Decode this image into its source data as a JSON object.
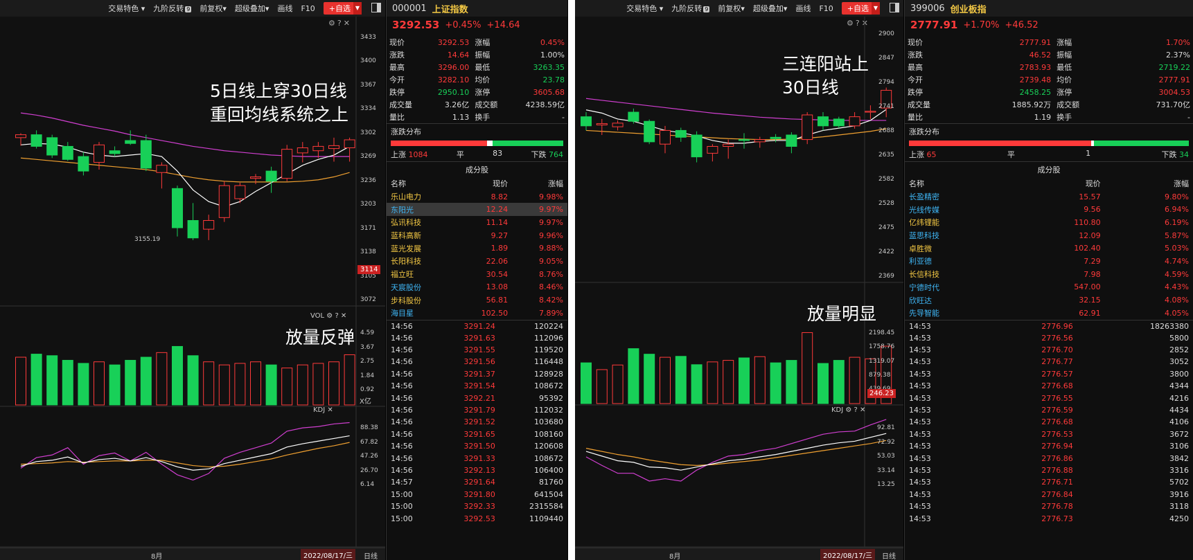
{
  "left_panel": {
    "toolbar": {
      "trade_feature": "交易特色",
      "nine_reversal": "九阶反转",
      "nine_badge": "9",
      "pre_adjust": "前复权",
      "overlay": "超级叠加",
      "draw_line": "画线",
      "f10": "F10",
      "add_watch": "+自选"
    },
    "price_axis": [
      "3433",
      "3400",
      "3367",
      "3334",
      "3302",
      "3269",
      "3236",
      "3203",
      "3171",
      "3138",
      "3105",
      "3072"
    ],
    "current_price_tag": "3114",
    "low_marker": "3155.19",
    "annotation_line1": "5日线上穿30日线",
    "annotation_line2": "重回均线系统之上",
    "vol_label": "VOL",
    "vol_axis": [
      "4.59",
      "3.67",
      "2.75",
      "1.84",
      "0.92"
    ],
    "vol_unit": "X亿",
    "vol_annotation": "放量反弹",
    "kdj_label": "KDJ",
    "kdj_axis": [
      "88.38",
      "67.82",
      "47.26",
      "26.70",
      "6.14"
    ],
    "month_label": "8月",
    "date_label": "2022/08/17/三",
    "period_label": "日线"
  },
  "left_quote": {
    "code": "000001",
    "name": "上证指数",
    "price": "3292.53",
    "pct": "+0.45%",
    "chg": "+14.64",
    "rows": [
      {
        "k1": "现价",
        "v1": "3292.53",
        "c1": "red",
        "k2": "涨幅",
        "v2": "0.45%",
        "c2": "red"
      },
      {
        "k1": "涨跌",
        "v1": "14.64",
        "c1": "red",
        "k2": "振幅",
        "v2": "1.00%",
        "c2": "white"
      },
      {
        "k1": "最高",
        "v1": "3296.00",
        "c1": "red",
        "k2": "最低",
        "v2": "3263.35",
        "c2": "green"
      },
      {
        "k1": "今开",
        "v1": "3282.10",
        "c1": "red",
        "k2": "均价",
        "v2": "23.78",
        "c2": "green"
      },
      {
        "k1": "跌停",
        "v1": "2950.10",
        "c1": "green",
        "k2": "涨停",
        "v2": "3605.68",
        "c2": "red"
      },
      {
        "k1": "成交量",
        "v1": "3.26亿",
        "c1": "white",
        "k2": "成交额",
        "v2": "4238.59亿",
        "c2": "white"
      },
      {
        "k1": "量比",
        "v1": "1.13",
        "c1": "white",
        "k2": "换手",
        "v2": "-",
        "c2": "white"
      }
    ],
    "dist_title": "涨跌分布",
    "up_label": "上涨",
    "up_count": "1084",
    "flat_label": "平",
    "flat_count": "83",
    "down_label": "下跌",
    "down_count": "764",
    "dist_up_frac": 0.56,
    "dist_flat_frac": 0.03,
    "const_title": "成分股",
    "const_headers": [
      "名称",
      "现价",
      "涨幅"
    ],
    "constituents": [
      {
        "name": "乐山电力",
        "price": "8.82",
        "pct": "9.98%",
        "nc": "yellow"
      },
      {
        "name": "东阳光",
        "price": "12.24",
        "pct": "9.97%",
        "nc": "blue"
      },
      {
        "name": "弘讯科技",
        "price": "11.14",
        "pct": "9.97%",
        "nc": "yellow"
      },
      {
        "name": "蓝科高新",
        "price": "9.27",
        "pct": "9.96%",
        "nc": "yellow"
      },
      {
        "name": "蓝光发展",
        "price": "1.89",
        "pct": "9.88%",
        "nc": "yellow"
      },
      {
        "name": "长阳科技",
        "price": "22.06",
        "pct": "9.05%",
        "nc": "yellow"
      },
      {
        "name": "福立旺",
        "price": "30.54",
        "pct": "8.76%",
        "nc": "yellow"
      },
      {
        "name": "天宸股份",
        "price": "13.08",
        "pct": "8.46%",
        "nc": "blue"
      },
      {
        "name": "步科股份",
        "price": "56.81",
        "pct": "8.42%",
        "nc": "yellow"
      },
      {
        "name": "海目星",
        "price": "102.50",
        "pct": "7.89%",
        "nc": "blue"
      }
    ],
    "ticks": [
      [
        "14:56",
        "3291.24",
        "120224"
      ],
      [
        "14:56",
        "3291.63",
        "112096"
      ],
      [
        "14:56",
        "3291.55",
        "119520"
      ],
      [
        "14:56",
        "3291.56",
        "116448"
      ],
      [
        "14:56",
        "3291.37",
        "128928"
      ],
      [
        "14:56",
        "3291.54",
        "108672"
      ],
      [
        "14:56",
        "3292.21",
        "95392"
      ],
      [
        "14:56",
        "3291.79",
        "112032"
      ],
      [
        "14:56",
        "3291.52",
        "103680"
      ],
      [
        "14:56",
        "3291.65",
        "108160"
      ],
      [
        "14:56",
        "3291.50",
        "120608"
      ],
      [
        "14:56",
        "3291.33",
        "108672"
      ],
      [
        "14:56",
        "3292.13",
        "106400"
      ],
      [
        "14:57",
        "3291.64",
        "81760"
      ],
      [
        "15:00",
        "3291.80",
        "641504"
      ],
      [
        "15:00",
        "3292.33",
        "2315584"
      ],
      [
        "15:00",
        "3292.53",
        "1109440"
      ]
    ]
  },
  "right_panel": {
    "toolbar": {
      "trade_feature": "交易特色",
      "nine_reversal": "九阶反转",
      "nine_badge": "9",
      "pre_adjust": "前复权",
      "overlay": "超级叠加",
      "draw_line": "画线",
      "f10": "F10",
      "add_watch": "+自选"
    },
    "price_axis": [
      "2900",
      "2847",
      "2794",
      "2741",
      "2688",
      "2635",
      "2582",
      "2528",
      "2475",
      "2422",
      "2369"
    ],
    "annotation_line1": "三连阳站上",
    "annotation_line2": "30日线",
    "vol_annotation": "放量明显",
    "vol_axis": [
      "2198.45",
      "1758.76",
      "1319.07",
      "879.38",
      "439.69"
    ],
    "current_vol_tag": "246.23",
    "kdj_label": "KDJ",
    "kdj_axis": [
      "92.81",
      "72.92",
      "53.03",
      "33.14",
      "13.25"
    ],
    "month_label": "8月",
    "date_label": "2022/08/17/三",
    "period_label": "日线"
  },
  "right_quote": {
    "code": "399006",
    "name": "创业板指",
    "price": "2777.91",
    "pct": "+1.70%",
    "chg": "+46.52",
    "rows": [
      {
        "k1": "现价",
        "v1": "2777.91",
        "c1": "red",
        "k2": "涨幅",
        "v2": "1.70%",
        "c2": "red"
      },
      {
        "k1": "涨跌",
        "v1": "46.52",
        "c1": "red",
        "k2": "振幅",
        "v2": "2.37%",
        "c2": "white"
      },
      {
        "k1": "最高",
        "v1": "2783.93",
        "c1": "red",
        "k2": "最低",
        "v2": "2719.22",
        "c2": "green"
      },
      {
        "k1": "今开",
        "v1": "2739.48",
        "c1": "red",
        "k2": "均价",
        "v2": "2777.91",
        "c2": "red"
      },
      {
        "k1": "跌停",
        "v1": "2458.25",
        "c1": "green",
        "k2": "涨停",
        "v2": "3004.53",
        "c2": "red"
      },
      {
        "k1": "成交量",
        "v1": "1885.92万",
        "c1": "white",
        "k2": "成交额",
        "v2": "731.70亿",
        "c2": "white"
      },
      {
        "k1": "量比",
        "v1": "1.19",
        "c1": "white",
        "k2": "换手",
        "v2": "-",
        "c2": "white"
      }
    ],
    "dist_title": "涨跌分布",
    "up_label": "上涨",
    "up_count": "65",
    "flat_label": "平",
    "flat_count": "1",
    "down_label": "下跌",
    "down_count": "34",
    "dist_up_frac": 0.65,
    "dist_flat_frac": 0.01,
    "const_title": "成分股",
    "const_headers": [
      "名称",
      "现价",
      "涨幅"
    ],
    "constituents": [
      {
        "name": "长盈精密",
        "price": "15.57",
        "pct": "9.80%",
        "nc": "blue"
      },
      {
        "name": "光线传媒",
        "price": "9.56",
        "pct": "6.94%",
        "nc": "blue"
      },
      {
        "name": "亿纬锂能",
        "price": "110.80",
        "pct": "6.19%",
        "nc": "yellow"
      },
      {
        "name": "蓝思科技",
        "price": "12.09",
        "pct": "5.87%",
        "nc": "blue"
      },
      {
        "name": "卓胜微",
        "price": "102.40",
        "pct": "5.03%",
        "nc": "yellow"
      },
      {
        "name": "利亚德",
        "price": "7.29",
        "pct": "4.74%",
        "nc": "blue"
      },
      {
        "name": "长信科技",
        "price": "7.98",
        "pct": "4.59%",
        "nc": "yellow"
      },
      {
        "name": "宁德时代",
        "price": "547.00",
        "pct": "4.43%",
        "nc": "blue"
      },
      {
        "name": "欣旺达",
        "price": "32.15",
        "pct": "4.08%",
        "nc": "blue"
      },
      {
        "name": "先导智能",
        "price": "62.91",
        "pct": "4.05%",
        "nc": "blue"
      }
    ],
    "ticks": [
      [
        "14:53",
        "2776.96",
        "18263380"
      ],
      [
        "14:53",
        "2776.56",
        "5800"
      ],
      [
        "14:53",
        "2776.70",
        "2852"
      ],
      [
        "14:53",
        "2776.77",
        "3052"
      ],
      [
        "14:53",
        "2776.57",
        "3800"
      ],
      [
        "14:53",
        "2776.68",
        "4344"
      ],
      [
        "14:53",
        "2776.55",
        "4216"
      ],
      [
        "14:53",
        "2776.59",
        "4434"
      ],
      [
        "14:53",
        "2776.68",
        "4106"
      ],
      [
        "14:53",
        "2776.53",
        "3672"
      ],
      [
        "14:53",
        "2776.94",
        "3106"
      ],
      [
        "14:53",
        "2776.86",
        "3842"
      ],
      [
        "14:53",
        "2776.88",
        "3316"
      ],
      [
        "14:53",
        "2776.71",
        "5702"
      ],
      [
        "14:53",
        "2776.84",
        "3916"
      ],
      [
        "14:53",
        "2776.78",
        "3118"
      ],
      [
        "14:53",
        "2776.73",
        "4250"
      ]
    ]
  },
  "chart_data": [
    {
      "type": "candlestick",
      "title": "上证指数",
      "ylim": [
        3072,
        3433
      ],
      "candles": [
        {
          "o": 3296,
          "h": 3302,
          "l": 3285,
          "c": 3300
        },
        {
          "o": 3300,
          "h": 3306,
          "l": 3281,
          "c": 3284
        },
        {
          "o": 3296,
          "h": 3300,
          "l": 3268,
          "c": 3272
        },
        {
          "o": 3284,
          "h": 3290,
          "l": 3264,
          "c": 3266
        },
        {
          "o": 3270,
          "h": 3276,
          "l": 3244,
          "c": 3250
        },
        {
          "o": 3262,
          "h": 3290,
          "l": 3252,
          "c": 3286
        },
        {
          "o": 3278,
          "h": 3284,
          "l": 3270,
          "c": 3274
        },
        {
          "o": 3292,
          "h": 3306,
          "l": 3286,
          "c": 3288
        },
        {
          "o": 3292,
          "h": 3300,
          "l": 3250,
          "c": 3254
        },
        {
          "o": 3248,
          "h": 3262,
          "l": 3226,
          "c": 3258
        },
        {
          "o": 3226,
          "h": 3230,
          "l": 3160,
          "c": 3172
        },
        {
          "o": 3182,
          "h": 3206,
          "l": 3155,
          "c": 3158
        },
        {
          "o": 3170,
          "h": 3190,
          "l": 3155,
          "c": 3182
        },
        {
          "o": 3186,
          "h": 3236,
          "l": 3180,
          "c": 3230
        },
        {
          "o": 3212,
          "h": 3234,
          "l": 3206,
          "c": 3230
        },
        {
          "o": 3240,
          "h": 3246,
          "l": 3232,
          "c": 3242
        },
        {
          "o": 3250,
          "h": 3256,
          "l": 3220,
          "c": 3236
        },
        {
          "o": 3240,
          "h": 3286,
          "l": 3236,
          "c": 3280
        },
        {
          "o": 3275,
          "h": 3290,
          "l": 3262,
          "c": 3282
        },
        {
          "o": 3278,
          "h": 3290,
          "l": 3268,
          "c": 3284
        },
        {
          "o": 3281,
          "h": 3296,
          "l": 3263,
          "c": 3285
        },
        {
          "o": 3282,
          "h": 3296,
          "l": 3263,
          "c": 3293
        }
      ],
      "volumes": [
        3.1,
        3.3,
        3.2,
        2.9,
        2.7,
        2.8,
        2.6,
        2.9,
        3.1,
        3.4,
        3.8,
        3.2,
        2.8,
        2.6,
        2.7,
        2.8,
        2.6,
        2.4,
        2.6,
        2.7,
        2.8,
        3.26
      ],
      "kdj": {
        "k": [
          33,
          40,
          42,
          47,
          38,
          43,
          45,
          41,
          46,
          40,
          32,
          27,
          29,
          37,
          42,
          47,
          52,
          62,
          67,
          71,
          75,
          79
        ],
        "d": [
          36,
          37,
          38,
          40,
          39,
          40,
          41,
          41,
          42,
          42,
          38,
          34,
          32,
          33,
          36,
          40,
          44,
          50,
          55,
          60,
          64,
          69
        ],
        "j": [
          30,
          46,
          50,
          61,
          36,
          49,
          53,
          41,
          54,
          36,
          20,
          12,
          22,
          45,
          54,
          61,
          68,
          86,
          91,
          93,
          97,
          99
        ]
      },
      "ma": {
        "ma5": [
          3286,
          3288,
          3287,
          3283,
          3276,
          3272,
          3270,
          3272,
          3274,
          3270,
          3250,
          3224,
          3208,
          3201,
          3208,
          3222,
          3234,
          3246,
          3258,
          3266,
          3272,
          3284
        ],
        "ma30": [
          3268,
          3266,
          3264,
          3262,
          3260,
          3258,
          3256,
          3254,
          3252,
          3249,
          3245,
          3241,
          3238,
          3236,
          3235,
          3235,
          3235,
          3235,
          3236,
          3238,
          3242,
          3248
        ],
        "ma60": [
          3330,
          3327,
          3323,
          3318,
          3313,
          3309,
          3305,
          3300,
          3296,
          3292,
          3288,
          3284,
          3281,
          3278,
          3276,
          3274,
          3272,
          3271,
          3270,
          3270,
          3270,
          3270
        ]
      }
    },
    {
      "type": "candlestick",
      "title": "创业板指",
      "ylim": [
        2369,
        2900
      ],
      "candles": [
        {
          "o": 2720,
          "h": 2730,
          "l": 2690,
          "c": 2700
        },
        {
          "o": 2702,
          "h": 2715,
          "l": 2680,
          "c": 2705
        },
        {
          "o": 2698,
          "h": 2712,
          "l": 2690,
          "c": 2706
        },
        {
          "o": 2730,
          "h": 2738,
          "l": 2705,
          "c": 2710
        },
        {
          "o": 2710,
          "h": 2714,
          "l": 2660,
          "c": 2665
        },
        {
          "o": 2660,
          "h": 2700,
          "l": 2640,
          "c": 2690
        },
        {
          "o": 2690,
          "h": 2696,
          "l": 2665,
          "c": 2675
        },
        {
          "o": 2680,
          "h": 2688,
          "l": 2620,
          "c": 2632
        },
        {
          "o": 2640,
          "h": 2660,
          "l": 2622,
          "c": 2655
        },
        {
          "o": 2655,
          "h": 2670,
          "l": 2628,
          "c": 2660
        },
        {
          "o": 2670,
          "h": 2684,
          "l": 2650,
          "c": 2668
        },
        {
          "o": 2665,
          "h": 2676,
          "l": 2652,
          "c": 2670
        },
        {
          "o": 2675,
          "h": 2682,
          "l": 2664,
          "c": 2672
        },
        {
          "o": 2680,
          "h": 2686,
          "l": 2640,
          "c": 2655
        },
        {
          "o": 2670,
          "h": 2730,
          "l": 2660,
          "c": 2724
        },
        {
          "o": 2720,
          "h": 2730,
          "l": 2690,
          "c": 2700
        },
        {
          "o": 2715,
          "h": 2720,
          "l": 2695,
          "c": 2700
        },
        {
          "o": 2700,
          "h": 2730,
          "l": 2694,
          "c": 2720
        },
        {
          "o": 2730,
          "h": 2745,
          "l": 2715,
          "c": 2732
        },
        {
          "o": 2739,
          "h": 2784,
          "l": 2719,
          "c": 2778
        }
      ],
      "volumes": [
        1320,
        1100,
        1250,
        1780,
        1600,
        1500,
        1530,
        1260,
        1350,
        1400,
        1480,
        1520,
        1320,
        1400,
        2300,
        1300,
        1400,
        1500,
        1450,
        1860
      ],
      "kdj": {
        "k": [
          62,
          56,
          50,
          48,
          42,
          41,
          38,
          42,
          46,
          50,
          52,
          55,
          58,
          62,
          66,
          70,
          73,
          75,
          80,
          85
        ],
        "d": [
          66,
          62,
          58,
          55,
          51,
          48,
          45,
          44,
          45,
          47,
          49,
          51,
          54,
          57,
          60,
          63,
          66,
          69,
          72,
          76
        ],
        "j": [
          55,
          44,
          34,
          34,
          24,
          27,
          24,
          38,
          48,
          56,
          58,
          63,
          66,
          72,
          78,
          84,
          87,
          88,
          96,
          103
        ]
      },
      "ma": {
        "ma5": [
          2735,
          2728,
          2715,
          2710,
          2700,
          2690,
          2685,
          2678,
          2668,
          2662,
          2662,
          2666,
          2668,
          2668,
          2680,
          2690,
          2695,
          2700,
          2712,
          2736
        ],
        "ma30": [
          2690,
          2688,
          2686,
          2684,
          2682,
          2680,
          2678,
          2676,
          2674,
          2672,
          2671,
          2670,
          2670,
          2671,
          2673,
          2676,
          2680,
          2684,
          2688,
          2694
        ],
        "ma60": [
          2760,
          2756,
          2752,
          2748,
          2744,
          2740,
          2736,
          2732,
          2728,
          2725,
          2722,
          2719,
          2717,
          2715,
          2714,
          2713,
          2712,
          2712,
          2712,
          2712
        ]
      }
    }
  ],
  "colors": {
    "up": "#ff3a3a",
    "down": "#18d058",
    "ma5": "#ffffff",
    "ma30": "#f0a030",
    "ma60": "#d13fd1",
    "ma_long": "#3fc33f",
    "kdj_k": "#ffffff",
    "kdj_d": "#f0a030",
    "kdj_j": "#d13fd1"
  }
}
